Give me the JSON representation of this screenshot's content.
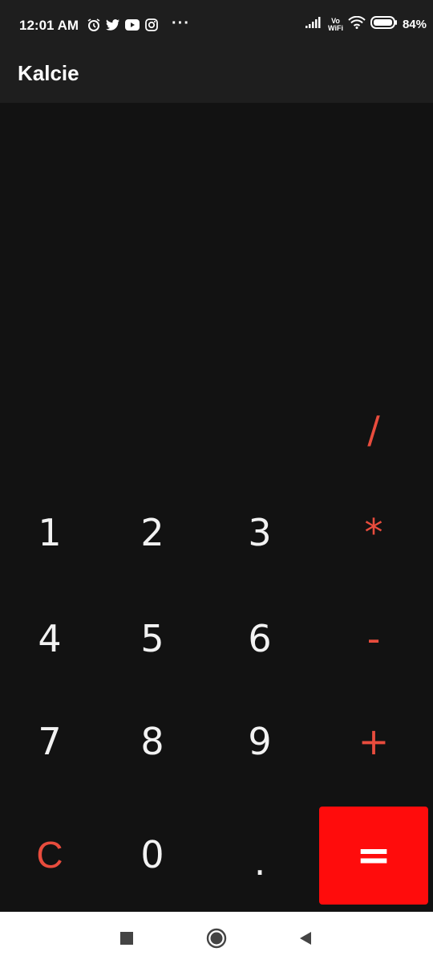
{
  "status": {
    "time": "12:01 AM",
    "network_label_top": "Vo",
    "network_label_bottom": "WiFi",
    "battery": "84%"
  },
  "app": {
    "title": "Kalcie"
  },
  "keys": {
    "divide": "/",
    "multiply": "*",
    "minus": "-",
    "plus": "+",
    "one": "1",
    "two": "2",
    "three": "3",
    "four": "4",
    "five": "5",
    "six": "6",
    "seven": "7",
    "eight": "8",
    "nine": "9",
    "clear": "C",
    "zero": "0",
    "dot": ".",
    "equals": "="
  },
  "colors": {
    "operator": "#e84c3d",
    "equals_bg": "#ff0c0c",
    "background": "#121212",
    "bar": "#1e1e1e"
  },
  "icons": [
    "alarm-icon",
    "twitter-icon",
    "youtube-icon",
    "instagram-icon",
    "signal-icon",
    "wifi-icon",
    "battery-icon",
    "recents-icon",
    "home-icon",
    "back-icon"
  ]
}
